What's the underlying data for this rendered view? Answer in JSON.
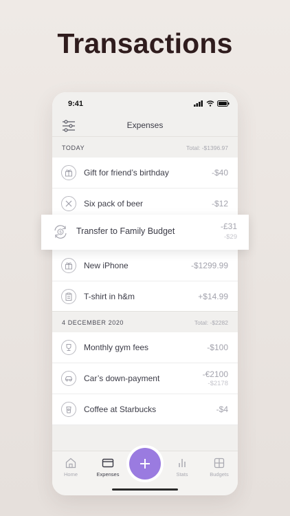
{
  "headline": "Transactions",
  "status": {
    "time": "9:41"
  },
  "nav": {
    "title": "Expenses"
  },
  "sections": [
    {
      "label": "TODAY",
      "total": "Total: -$1396.97"
    },
    {
      "label": "4 DECEMBER 2020",
      "total": "Total: -$2282"
    }
  ],
  "today": [
    {
      "name": "Gift for friend’s birthday",
      "amount": "-$40",
      "icon": "gift-icon"
    },
    {
      "name": "Six pack of beer",
      "amount": "-$12",
      "icon": "fork-knife-icon"
    },
    {
      "name": "New iPhone",
      "amount": "-$1299.99",
      "icon": "gift-icon"
    },
    {
      "name": "T-shirt in h&m",
      "amount": "+$14.99",
      "icon": "clipboard-icon"
    }
  ],
  "highlight": {
    "name": "Transfer to Family Budget",
    "amount": "-£31",
    "sub": "-$29",
    "icon": "transfer-icon"
  },
  "december": [
    {
      "name": "Monthly gym fees",
      "amount": "-$100",
      "icon": "trophy-icon"
    },
    {
      "name": "Car’s down-payment",
      "amount": "-€2100",
      "sub": "-$2178",
      "icon": "car-icon"
    },
    {
      "name": "Coffee at Starbucks",
      "amount": "-$4",
      "icon": "coffee-cup-icon"
    }
  ],
  "tabs": [
    {
      "label": "Home",
      "icon": "home-icon"
    },
    {
      "label": "Expenses",
      "icon": "wallet-icon",
      "active": true
    },
    {
      "label": "Stats",
      "icon": "bar-chart-icon"
    },
    {
      "label": "Budgets",
      "icon": "grid-icon"
    }
  ],
  "colors": {
    "accent": "#9a7be0",
    "headline": "#2f1c1d",
    "amount": "#a3a3ad"
  }
}
